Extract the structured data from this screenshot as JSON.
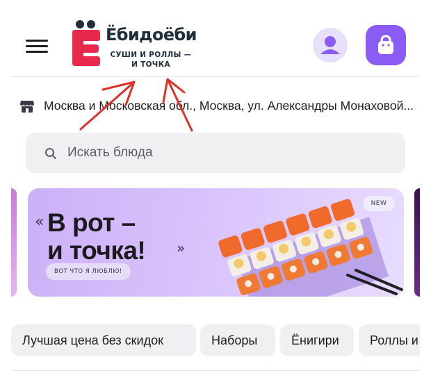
{
  "header": {
    "brand_name": "Ёбидоёби",
    "brand_tagline": "СУШИ И РОЛЛЫ — И ТОЧКА",
    "menu_icon": "hamburger-menu-icon",
    "profile_icon": "user-avatar-icon",
    "cart_icon": "shopping-bag-icon"
  },
  "address": {
    "icon": "store-icon",
    "text": "Москва и Московская обл., Москва, ул. Александры Монаховой..."
  },
  "search": {
    "placeholder": "Искать блюда",
    "icon": "search-icon"
  },
  "banner": {
    "headline_line1": "В рот –",
    "headline_line2": "и точка!",
    "quote_open": "«",
    "quote_close": "»",
    "pill": "ВОТ ЧТО Я ЛЮБЛЮ!",
    "badge": "NEW"
  },
  "categories": [
    "Лучшая цена без скидок",
    "Наборы",
    "Ёнигири",
    "Роллы и"
  ],
  "colors": {
    "accent": "#8a5cf5",
    "brand_red": "#e8294b",
    "brand_dark": "#1f2d3d",
    "annotation": "#e0302a"
  }
}
